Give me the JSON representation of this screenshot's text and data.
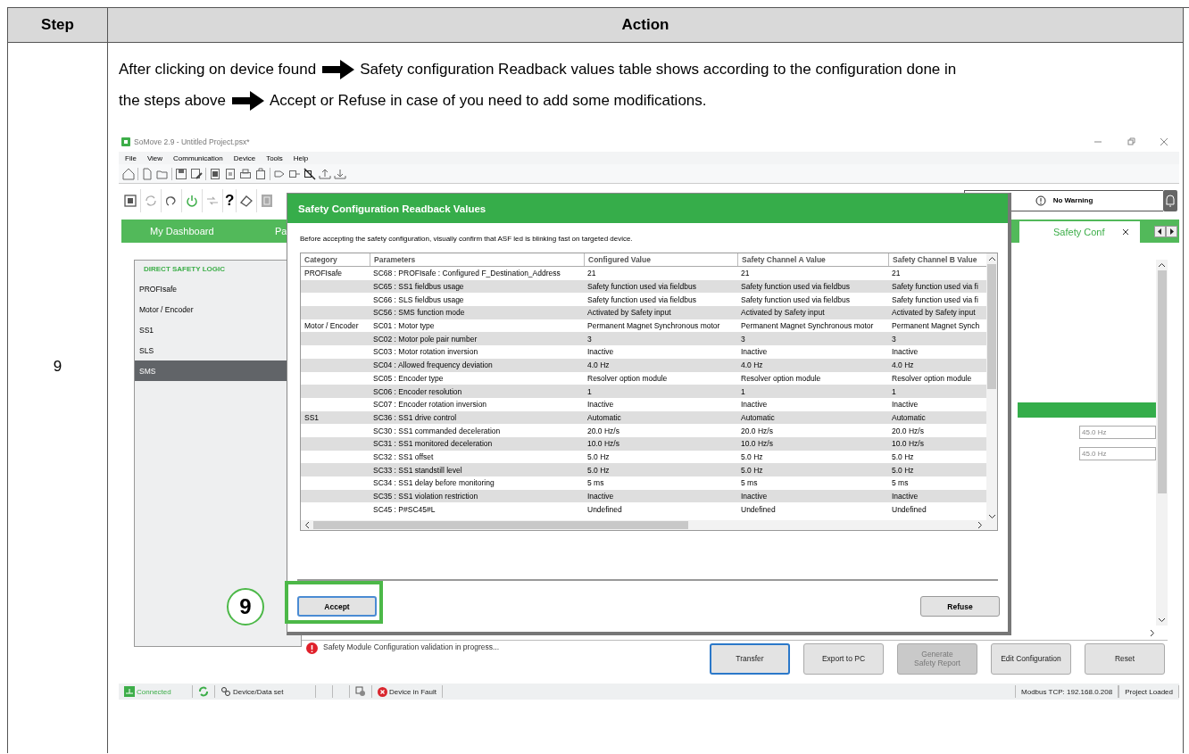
{
  "doc_table": {
    "columns": [
      "Step",
      "Action"
    ],
    "step": "9"
  },
  "instruction_lines": [
    [
      {
        "kind": "text",
        "text": "After clicking on device found"
      },
      {
        "kind": "arrow"
      },
      {
        "kind": "text",
        "text": "Safety configuration Readback values table shows according to the configuration done in"
      }
    ],
    [
      {
        "kind": "text",
        "text": "the steps above"
      },
      {
        "kind": "arrow"
      },
      {
        "kind": "text",
        "text": "Accept or Refuse in case of you need to add some modifications."
      }
    ]
  ],
  "app": {
    "title": "SoMove 2.9 - Untitled Project.psx*",
    "menu": [
      "File",
      "View",
      "Communication",
      "Device",
      "Tools",
      "Help"
    ],
    "help_glyph": "?",
    "warning": "No Warning",
    "tabs": [
      {
        "label": "My Dashboard",
        "selected": false
      },
      {
        "label": "Pa",
        "selected": false
      },
      {
        "label": "Safety Conf",
        "selected": true
      }
    ],
    "sidebar": {
      "title": "DIRECT SAFETY LOGIC",
      "items": [
        {
          "label": "PROFIsafe",
          "selected": false
        },
        {
          "label": "Motor / Encoder",
          "selected": false
        },
        {
          "label": "SS1",
          "selected": false
        },
        {
          "label": "SLS",
          "selected": false
        },
        {
          "label": "SMS",
          "selected": true
        }
      ]
    },
    "fields": [
      {
        "value": "45.0 Hz"
      },
      {
        "value": "45.0 Hz"
      }
    ],
    "message": "Safety Module Configuration validation in progress...",
    "buttons": [
      {
        "label": "Transfer",
        "disabled": false,
        "focused": true
      },
      {
        "label": "Export to PC",
        "disabled": false,
        "focused": false
      },
      {
        "label": "Generate Safety Report",
        "disabled": true,
        "focused": false
      },
      {
        "label": "Edit Configuration",
        "disabled": false,
        "focused": false
      },
      {
        "label": "Reset",
        "disabled": false,
        "focused": false
      }
    ],
    "status_bar": {
      "connection": "Connected",
      "device_data": "Device/Data set",
      "fault": "Device in Fault",
      "address": "Modbus TCP: 192.168.0.208",
      "project": "Project Loaded"
    }
  },
  "dialog": {
    "title": "Safety Configuration Readback Values",
    "note": "Before accepting the safety configuration, visually confirm that ASF led is blinking fast on targeted device.",
    "columns": [
      "Category",
      "Parameters",
      "Configured Value",
      "Safety Channel A Value",
      "Safety Channel B Value"
    ],
    "rows": [
      {
        "category": "PROFIsafe",
        "parameter": "SC68 : PROFIsafe : Configured F_Destination_Address",
        "configured": "21",
        "channel_a": "21",
        "channel_b": "21"
      },
      {
        "parameter": "SC65 : SS1 fieldbus usage",
        "configured": "Safety function used via fieldbus",
        "channel_a": "Safety function used via fieldbus",
        "channel_b": "Safety function used via fi"
      },
      {
        "parameter": "SC66 : SLS fieldbus usage",
        "configured": "Safety function used via fieldbus",
        "channel_a": "Safety function used via fieldbus",
        "channel_b": "Safety function used via fi"
      },
      {
        "parameter": "SC56 : SMS function mode",
        "configured": "Activated by Safety input",
        "channel_a": "Activated by Safety input",
        "channel_b": "Activated by Safety input"
      },
      {
        "category": "Motor / Encoder",
        "parameter": "SC01 : Motor type",
        "configured": "Permanent Magnet Synchronous motor",
        "channel_a": "Permanent Magnet Synchronous motor",
        "channel_b": "Permanent Magnet Synch"
      },
      {
        "parameter": "SC02 : Motor pole pair number",
        "configured": "3",
        "channel_a": "3",
        "channel_b": "3"
      },
      {
        "parameter": "SC03 : Motor rotation inversion",
        "configured": "Inactive",
        "channel_a": "Inactive",
        "channel_b": "Inactive"
      },
      {
        "parameter": "SC04 : Allowed frequency deviation",
        "configured": "4.0 Hz",
        "channel_a": "4.0 Hz",
        "channel_b": "4.0 Hz"
      },
      {
        "parameter": "SC05 : Encoder type",
        "configured": "Resolver option module",
        "channel_a": "Resolver option module",
        "channel_b": "Resolver option module"
      },
      {
        "parameter": "SC06 : Encoder resolution",
        "configured": "1",
        "channel_a": "1",
        "channel_b": "1"
      },
      {
        "parameter": "SC07 : Encoder rotation inversion",
        "configured": "Inactive",
        "channel_a": "Inactive",
        "channel_b": "Inactive"
      },
      {
        "category": "SS1",
        "parameter": "SC36 : SS1 drive control",
        "configured": "Automatic",
        "channel_a": "Automatic",
        "channel_b": "Automatic"
      },
      {
        "parameter": "SC30 : SS1 commanded deceleration",
        "configured": "20.0 Hz/s",
        "channel_a": "20.0 Hz/s",
        "channel_b": "20.0 Hz/s"
      },
      {
        "parameter": "SC31 : SS1 monitored deceleration",
        "configured": "10.0 Hz/s",
        "channel_a": "10.0 Hz/s",
        "channel_b": "10.0 Hz/s"
      },
      {
        "parameter": "SC32 : SS1 offset",
        "configured": "5.0 Hz",
        "channel_a": "5.0 Hz",
        "channel_b": "5.0 Hz"
      },
      {
        "parameter": "SC33 : SS1 standstill level",
        "configured": "5.0 Hz",
        "channel_a": "5.0 Hz",
        "channel_b": "5.0 Hz"
      },
      {
        "parameter": "SC34 : SS1 delay before monitoring",
        "configured": "5 ms",
        "channel_a": "5 ms",
        "channel_b": "5 ms"
      },
      {
        "parameter": "SC35 : SS1 violation restriction",
        "configured": "Inactive",
        "channel_a": "Inactive",
        "channel_b": "Inactive"
      },
      {
        "parameter": "SC45 : P#SC45#L",
        "configured": "Undefined",
        "channel_a": "Undefined",
        "channel_b": "Undefined"
      }
    ],
    "buttons": [
      {
        "label": "Accept",
        "focused": true,
        "highlighted": true
      },
      {
        "label": "Refuse",
        "focused": false,
        "highlighted": false
      }
    ]
  },
  "callout": {
    "number": "9"
  }
}
